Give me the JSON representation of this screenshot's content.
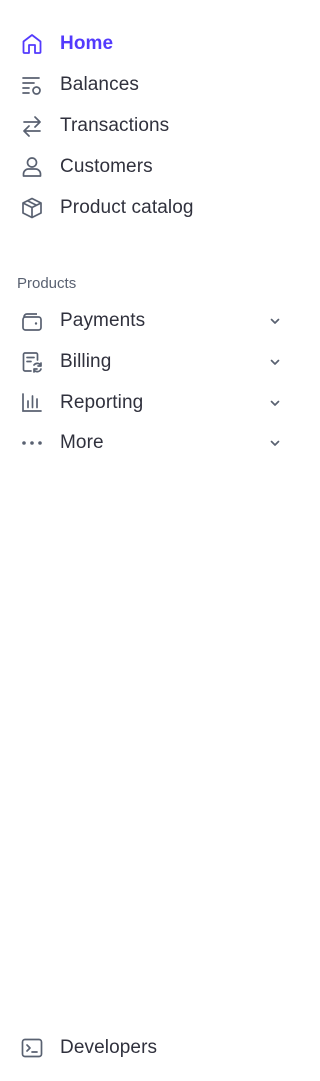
{
  "colors": {
    "active": "#533afd",
    "icon": "#596171",
    "text": "#30313d"
  },
  "nav": {
    "primary": [
      {
        "label": "Home",
        "icon": "home-icon",
        "active": true
      },
      {
        "label": "Balances",
        "icon": "balances-icon"
      },
      {
        "label": "Transactions",
        "icon": "transactions-icon"
      },
      {
        "label": "Customers",
        "icon": "customer-icon"
      },
      {
        "label": "Product catalog",
        "icon": "product-catalog-icon"
      }
    ],
    "products_heading": "Products",
    "products": [
      {
        "label": "Payments",
        "icon": "wallet-icon",
        "expandable": true
      },
      {
        "label": "Billing",
        "icon": "billing-icon",
        "expandable": true
      },
      {
        "label": "Reporting",
        "icon": "reporting-icon",
        "expandable": true
      },
      {
        "label": "More",
        "icon": "more-icon",
        "expandable": true
      }
    ],
    "footer": [
      {
        "label": "Developers",
        "icon": "terminal-icon"
      }
    ]
  }
}
